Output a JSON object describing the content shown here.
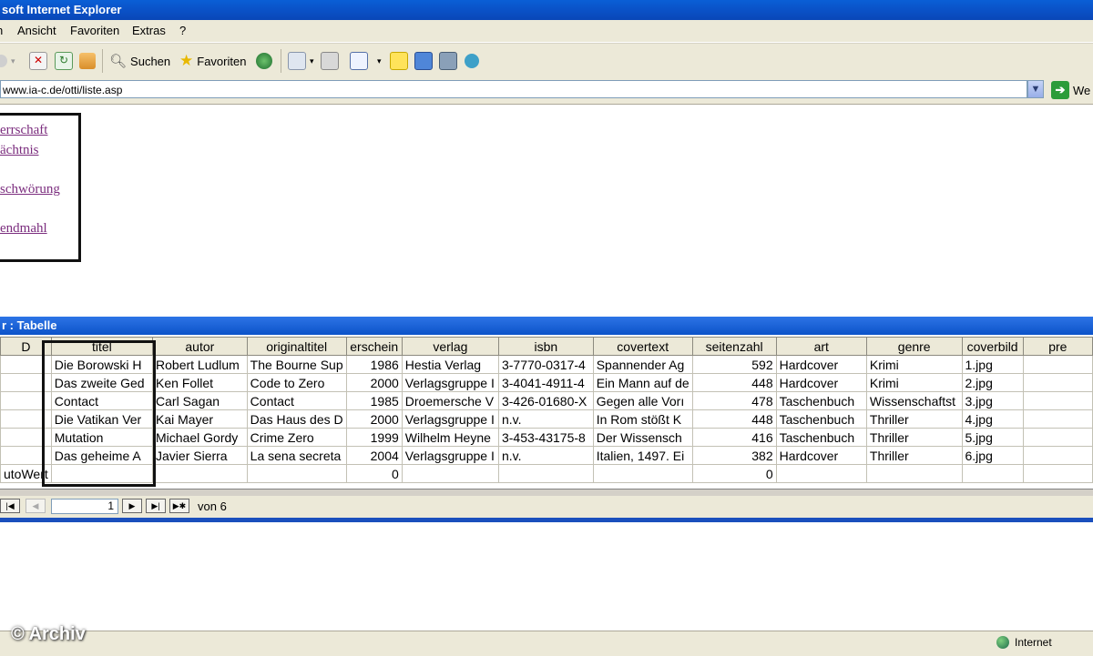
{
  "window": {
    "title": "soft Internet Explorer"
  },
  "menu": [
    "n",
    "Ansicht",
    "Favoriten",
    "Extras",
    "?"
  ],
  "toolbar": {
    "search_label": "Suchen",
    "favorites_label": "Favoriten"
  },
  "address": {
    "url": "www.ia-c.de/otti/liste.asp",
    "go_label": "We"
  },
  "links": [
    "errschaft",
    "ächtnis",
    "schwörung",
    "endmahl"
  ],
  "datasheet": {
    "title": "r : Tabelle",
    "columns": [
      "D",
      "titel",
      "autor",
      "originaltitel",
      "erschein",
      "verlag",
      "isbn",
      "covertext",
      "seitenzahl",
      "art",
      "genre",
      "coverbild",
      "pre"
    ],
    "rows": [
      [
        "",
        "Die Borowski H",
        "Robert Ludlum",
        "The Bourne Sup",
        "1986",
        "Hestia Verlag",
        "3-7770-0317-4",
        "Spannender Ag",
        "592",
        "Hardcover",
        "Krimi",
        "1.jpg",
        ""
      ],
      [
        "",
        "Das zweite Ged",
        "Ken Follet",
        "Code to Zero",
        "2000",
        "Verlagsgruppe I",
        "3-4041-4911-4",
        "Ein Mann auf de",
        "448",
        "Hardcover",
        "Krimi",
        "2.jpg",
        ""
      ],
      [
        "",
        "Contact",
        "Carl Sagan",
        "Contact",
        "1985",
        "Droemersche V",
        "3-426-01680-X",
        "Gegen alle Vorı",
        "478",
        "Taschenbuch",
        "Wissenschaftst",
        "3.jpg",
        ""
      ],
      [
        "",
        "Die Vatikan Ver",
        "Kai Mayer",
        "Das Haus des D",
        "2000",
        "Verlagsgruppe I",
        "n.v.",
        "In Rom stößt K",
        "448",
        "Taschenbuch",
        "Thriller",
        "4.jpg",
        ""
      ],
      [
        "",
        "Mutation",
        "Michael Gordy",
        "Crime Zero",
        "1999",
        "Wilhelm Heyne",
        "3-453-43175-8",
        "Der Wissensch",
        "416",
        "Taschenbuch",
        "Thriller",
        "5.jpg",
        ""
      ],
      [
        "",
        "Das geheime A",
        "Javier Sierra",
        "La sena secreta",
        "2004",
        "Verlagsgruppe I",
        "n.v.",
        "Italien, 1497. Ei",
        "382",
        "Hardcover",
        "Thriller",
        "6.jpg",
        ""
      ],
      [
        "utoWert",
        "",
        "",
        "",
        "0",
        "",
        "",
        "",
        "0",
        "",
        "",
        "",
        ""
      ]
    ]
  },
  "record_nav": {
    "current": "1",
    "of_label": "von 6"
  },
  "status": {
    "zone": "Internet"
  },
  "watermark": "© Archiv"
}
